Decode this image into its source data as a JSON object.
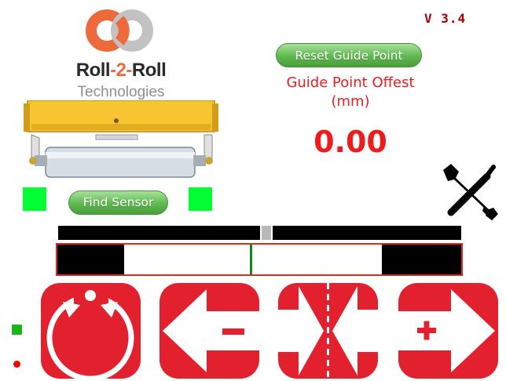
{
  "header": {
    "version": "V 3.4"
  },
  "logo": {
    "name_part1": "Roll",
    "name_part2": "-2-",
    "name_part3": "Roll",
    "subtitle": "Technologies"
  },
  "guide": {
    "reset_label": "Reset Guide Point",
    "offset_title_line1": "Guide Point Offest",
    "offset_title_line2": "(mm)",
    "offset_value": "0.00"
  },
  "sensor": {
    "find_label": "Find Sensor"
  },
  "controls": {
    "auto": "auto-mode-icon",
    "left": "move-left-minus-icon",
    "center": "center-icon",
    "right": "move-right-plus-icon"
  },
  "colors": {
    "accent_red": "#e3202e",
    "sensor_green": "#00ff33",
    "text_red": "#ee1c1c",
    "button_green": "#5fb84f"
  }
}
